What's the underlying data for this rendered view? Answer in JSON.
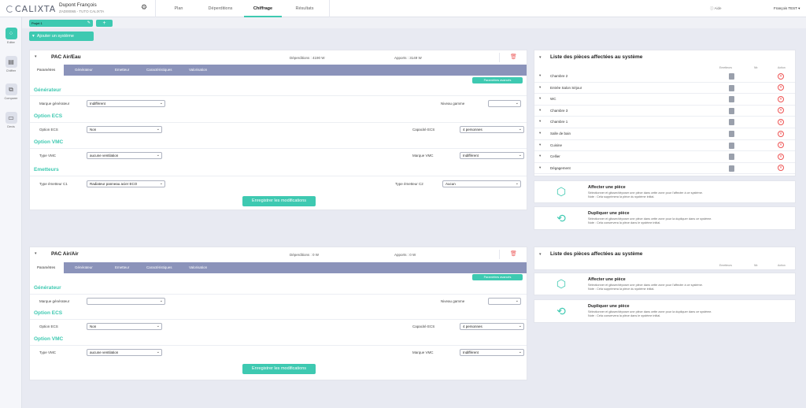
{
  "app": {
    "logo": "CALIXTA",
    "user_name": "Dupont François",
    "client_code": "ZAD00065 - TUTO CALIXTA",
    "aide": "Aide",
    "account": "François TEST"
  },
  "nav": [
    "Plan",
    "Déperditions",
    "Chiffrage",
    "Résultats"
  ],
  "sidebar": [
    "Editer",
    "Chiffrer",
    "Comparer",
    "Devis"
  ],
  "project_tab": "Projet 1",
  "add_tab": "+",
  "add_system": "Ajouter un système",
  "sub_tabs": [
    "Paramètres",
    "Générateur",
    "Emetteur",
    "Caractéristiques",
    "Valorisation"
  ],
  "param_btn": "Paramètres avancés",
  "save_btn": "Enregistrer les modifications",
  "systems": [
    {
      "title": "PAC Air/Eau",
      "deperditions": "Déperditions : 4190 W",
      "apports": "Apports : 3149 W",
      "generateur": {
        "title": "Générateur",
        "marque_label": "Marque générateur",
        "marque_value": "Indifférent",
        "niveau_label": "Niveau gamme",
        "niveau_value": ""
      },
      "ecs": {
        "title": "Option ECS",
        "option_label": "Option ECS",
        "option_value": "Non",
        "capacite_label": "Capacité ECS",
        "capacite_value": "4 personnes"
      },
      "vmc": {
        "title": "Option VMC",
        "type_label": "Type VMC",
        "type_value": "aucune ventilation",
        "marque_label": "Marque VMC",
        "marque_value": "Indifférent"
      },
      "emetteurs": {
        "title": "Emetteurs",
        "c1_label": "Type émetteur C1",
        "c1_value": "Radiateur panneau acier ECO",
        "c2_label": "Type émetteur C2",
        "c2_value": "Aucun"
      }
    },
    {
      "title": "PAC Air/Air",
      "deperditions": "Déperditions : 0 W",
      "apports": "Apports : 0 W",
      "generateur": {
        "title": "Générateur",
        "marque_label": "Marque générateur",
        "marque_value": "",
        "niveau_label": "Niveau gamme",
        "niveau_value": ""
      },
      "ecs": {
        "title": "Option ECS",
        "option_label": "Option ECS",
        "option_value": "Non",
        "capacite_label": "Capacité ECS",
        "capacite_value": "4 personnes"
      },
      "vmc": {
        "title": "Option VMC",
        "type_label": "Type VMC",
        "type_value": "aucune ventilation",
        "marque_label": "Marque VMC",
        "marque_value": "Indifférent"
      }
    }
  ],
  "rooms_panel": {
    "title": "Liste des pièces affectées au système",
    "col_emetteurs": "Emetteurs",
    "col_nb": "Nb",
    "col_action": "Action"
  },
  "rooms": [
    "Chambre 2",
    "Entrée Salon Séjour",
    "WC",
    "Chambre 3",
    "Chambre 1",
    "Salle de bain",
    "Cuisine",
    "Cellier",
    "Dégagement"
  ],
  "affect_card": {
    "title": "Affecter une pièce",
    "desc": "Sélectionner et glisser/déposer une pièce dans cette zone pour l'affecter à ce système.",
    "note": "Note : Cela supprimera la pièce du système initial."
  },
  "dup_card": {
    "title": "Dupliquer une pièce",
    "desc": "Sélectionner et glisser/déposer une pièce dans cette zone pour la dupliquer dans ce système.",
    "note": "Note : Cela conservera la pièce dans le système initial."
  },
  "icons": {
    "gear": "gear-icon",
    "trash": "trash-icon",
    "chevron": "chevron-down-icon",
    "pencil": "pencil-icon",
    "delete": "delete-circle-icon",
    "document": "document-icon",
    "cube": "cube-icon",
    "duplicate": "duplicate-icon"
  },
  "colors": {
    "accent": "#3ec9b1",
    "tabs": "#8b93ba",
    "delete": "#e55555"
  }
}
